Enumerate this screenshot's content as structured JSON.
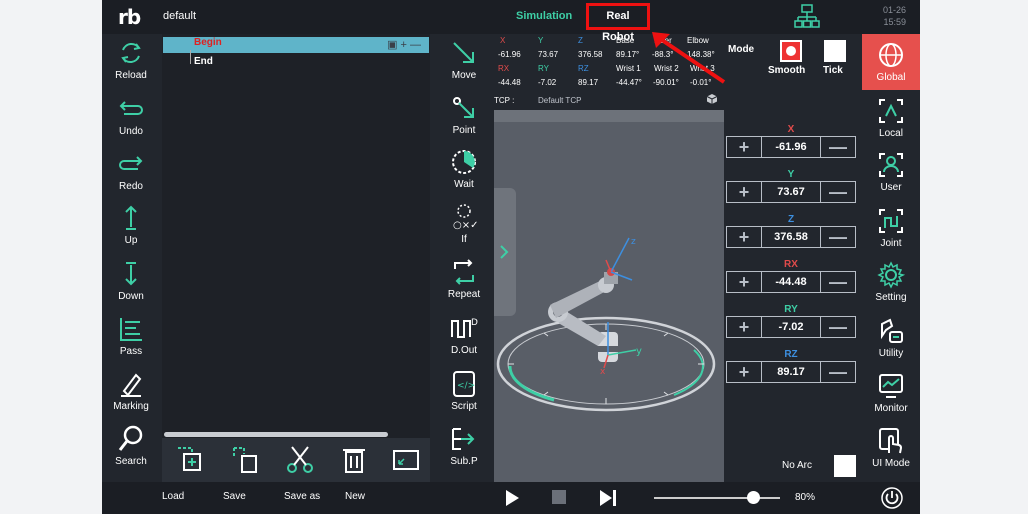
{
  "header": {
    "logo": "rb",
    "filename": "default",
    "tabs": {
      "simulation": "Simulation",
      "real_robot": "Real Robot"
    },
    "date": "01-26",
    "time": "15:59"
  },
  "left_tools": [
    {
      "label": "Reload",
      "icon": "reload-icon"
    },
    {
      "label": "Undo",
      "icon": "undo-icon"
    },
    {
      "label": "Redo",
      "icon": "redo-icon"
    },
    {
      "label": "Up",
      "icon": "up-icon"
    },
    {
      "label": "Down",
      "icon": "down-icon"
    },
    {
      "label": "Pass",
      "icon": "pass-icon"
    },
    {
      "label": "Marking",
      "icon": "marking-icon"
    },
    {
      "label": "Search",
      "icon": "search-icon"
    }
  ],
  "program": {
    "begin": "Begin",
    "end": "End"
  },
  "edit_tools": [
    {
      "icon": "copy-icon"
    },
    {
      "icon": "paste-icon"
    },
    {
      "icon": "cut-icon"
    },
    {
      "icon": "delete-icon"
    },
    {
      "icon": "expand-icon"
    }
  ],
  "mid_tools": [
    {
      "label": "Move",
      "icon": "move-icon"
    },
    {
      "label": "Point",
      "icon": "point-icon"
    },
    {
      "label": "Wait",
      "icon": "wait-icon"
    },
    {
      "label": "If",
      "icon": "if-icon"
    },
    {
      "label": "Repeat",
      "icon": "repeat-icon"
    },
    {
      "label": "D.Out",
      "icon": "digital-out-icon"
    },
    {
      "label": "Script",
      "icon": "script-icon"
    },
    {
      "label": "Sub.P",
      "icon": "subprogram-icon"
    }
  ],
  "info": {
    "headers1": [
      "X",
      "Y",
      "Z",
      "Base",
      "ulder",
      "Elbow"
    ],
    "values1": [
      "-61.96",
      "73.67",
      "376.58",
      "89.17°",
      "-88.3°",
      "148.38°"
    ],
    "headers2": [
      "RX",
      "RY",
      "RZ",
      "Wrist 1",
      "Wrist 2",
      "Wrist 3"
    ],
    "values2": [
      "-44.48",
      "-7.02",
      "89.17",
      "-44.47°",
      "-90.01°",
      "-0.01°"
    ],
    "tcp_label": "TCP :",
    "tcp_value": "Default TCP"
  },
  "mode": {
    "label": "Mode",
    "smooth": "Smooth",
    "tick": "Tick"
  },
  "jog": [
    {
      "axis": "X",
      "value": "-61.96",
      "color": "#e14b4b"
    },
    {
      "axis": "Y",
      "value": "73.67",
      "color": "#3ecfa6"
    },
    {
      "axis": "Z",
      "value": "376.58",
      "color": "#3d8fe0"
    },
    {
      "axis": "RX",
      "value": "-44.48",
      "color": "#e14b4b"
    },
    {
      "axis": "RY",
      "value": "-7.02",
      "color": "#3ecfa6"
    },
    {
      "axis": "RZ",
      "value": "89.17",
      "color": "#3d8fe0"
    }
  ],
  "no_arc": "No Arc",
  "right_tools": [
    {
      "label": "Global",
      "icon": "globe-icon"
    },
    {
      "label": "Local",
      "icon": "local-icon"
    },
    {
      "label": "User",
      "icon": "user-icon"
    },
    {
      "label": "Joint",
      "icon": "joint-icon"
    },
    {
      "label": "Setting",
      "icon": "gear-icon"
    },
    {
      "label": "Utility",
      "icon": "utility-icon"
    },
    {
      "label": "Monitor",
      "icon": "monitor-icon"
    },
    {
      "label": "UI Mode",
      "icon": "touch-icon"
    }
  ],
  "footer": {
    "load": "Load",
    "save": "Save",
    "save_as": "Save as",
    "new": "New",
    "speed": "80%",
    "speed_fraction": 0.8
  },
  "colors": {
    "accent_red": "#e6504d",
    "accent_teal": "#3ecfa6",
    "annotation_red": "#ee1111"
  }
}
